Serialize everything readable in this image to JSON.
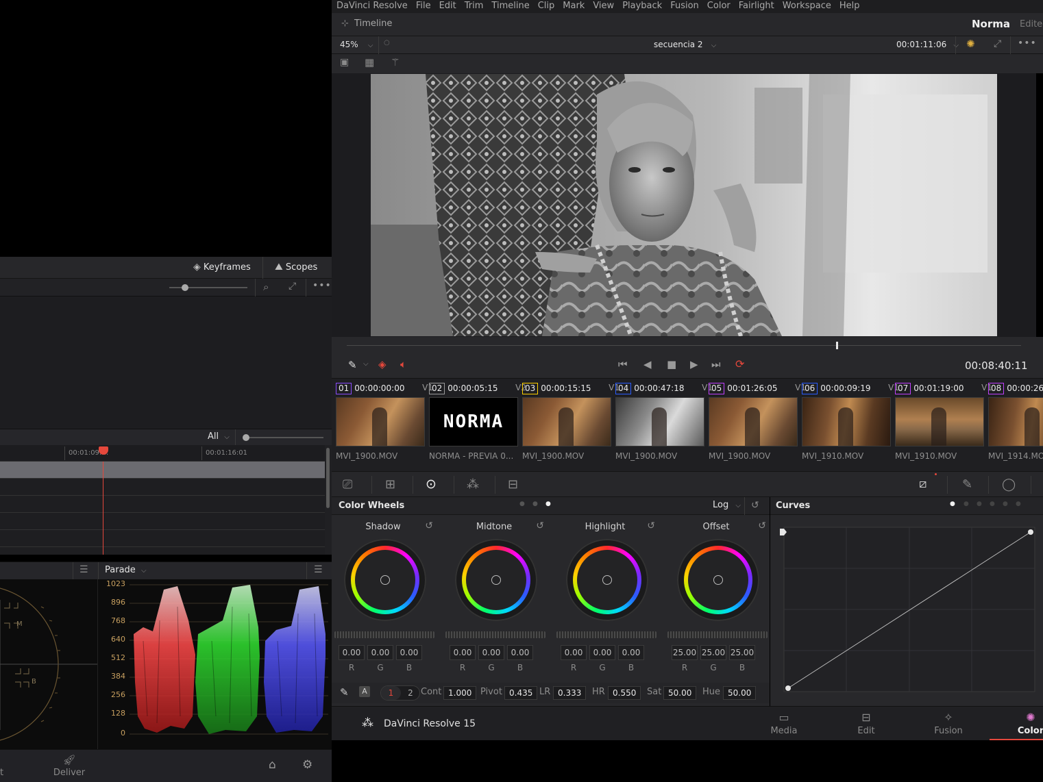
{
  "app": {
    "name": "DaVinci Resolve",
    "version_label": "DaVinci Resolve 15",
    "project_title": "Norma",
    "project_status": "Edited"
  },
  "menu": [
    "DaVinci Resolve",
    "File",
    "Edit",
    "Trim",
    "Timeline",
    "Clip",
    "Mark",
    "View",
    "Playback",
    "Fusion",
    "Color",
    "Fairlight",
    "Workspace",
    "Help"
  ],
  "titlebar": {
    "timeline_label": "Timeline"
  },
  "viewer": {
    "zoom": "45%",
    "timeline_name": "secuencia 2",
    "timecode_top": "00:01:11:06",
    "timecode_transport": "00:08:40:11"
  },
  "left": {
    "keyframes_label": "Keyframes",
    "scopes_label": "Scopes",
    "filter_label": "All",
    "ruler_tc1": "00:01:09:…",
    "ruler_tc2": "00:01:16:01",
    "scope_type": "Parade",
    "parade_ticks": [
      "1023",
      "896",
      "768",
      "640",
      "512",
      "384",
      "256",
      "128",
      "0"
    ],
    "vector_labels": [
      "M",
      "B"
    ],
    "bottom_page_partial": "t",
    "deliver_label": "Deliver"
  },
  "clips": [
    {
      "num": "01",
      "tc": "00:00:00:00",
      "track": "V1",
      "name": "MVI_1900.MOV",
      "ring": "#8a4dff",
      "thumb": "warm"
    },
    {
      "num": "02",
      "tc": "00:00:05:15",
      "track": "V2",
      "name": "NORMA - PREVIA 0...",
      "ring": "#9a9a9a",
      "thumb": "title",
      "title_text": "NORMA"
    },
    {
      "num": "03",
      "tc": "00:00:15:15",
      "track": "V1",
      "name": "MVI_1900.MOV",
      "ring": "#ffd000",
      "thumb": "warm"
    },
    {
      "num": "04",
      "tc": "00:00:47:18",
      "track": "V1",
      "name": "MVI_1900.MOV",
      "ring": "#2a5cff",
      "thumb": "gray"
    },
    {
      "num": "05",
      "tc": "00:01:26:05",
      "track": "V1",
      "name": "MVI_1900.MOV",
      "ring": "#c040ff",
      "thumb": "warm"
    },
    {
      "num": "06",
      "tc": "00:00:09:19",
      "track": "V1",
      "name": "MVI_1910.MOV",
      "ring": "#2a5cff",
      "thumb": "motion"
    },
    {
      "num": "07",
      "tc": "00:01:19:00",
      "track": "V1",
      "name": "MVI_1910.MOV",
      "ring": "#c040ff",
      "thumb": "room"
    },
    {
      "num": "08",
      "tc": "00:00:26",
      "track": "",
      "name": "MVI_1914.MO",
      "ring": "#c040ff",
      "thumb": "motion"
    }
  ],
  "color_wheels": {
    "panel_title": "Color Wheels",
    "mode": "Log",
    "wheels": [
      {
        "label": "Shadow",
        "r": "0.00",
        "g": "0.00",
        "b": "0.00"
      },
      {
        "label": "Midtone",
        "r": "0.00",
        "g": "0.00",
        "b": "0.00"
      },
      {
        "label": "Highlight",
        "r": "0.00",
        "g": "0.00",
        "b": "0.00"
      },
      {
        "label": "Offset",
        "r": "25.00",
        "g": "25.00",
        "b": "25.00"
      }
    ],
    "channel_labels": [
      "R",
      "G",
      "B"
    ],
    "adjustments": {
      "auto_label": "A",
      "page1": "1",
      "page2": "2",
      "cont_label": "Cont",
      "cont": "1.000",
      "pivot_label": "Pivot",
      "pivot": "0.435",
      "lr_label": "LR",
      "lr": "0.333",
      "hr_label": "HR",
      "hr": "0.550",
      "sat_label": "Sat",
      "sat": "50.00",
      "hue_label": "Hue",
      "hue": "50.00"
    }
  },
  "curves": {
    "panel_title": "Curves"
  },
  "pages": [
    "Media",
    "Edit",
    "Fusion",
    "Color"
  ],
  "colors": {
    "accent_red": "#e5483c",
    "active_page": "#e5483c",
    "panel_bg": "#28282b"
  }
}
